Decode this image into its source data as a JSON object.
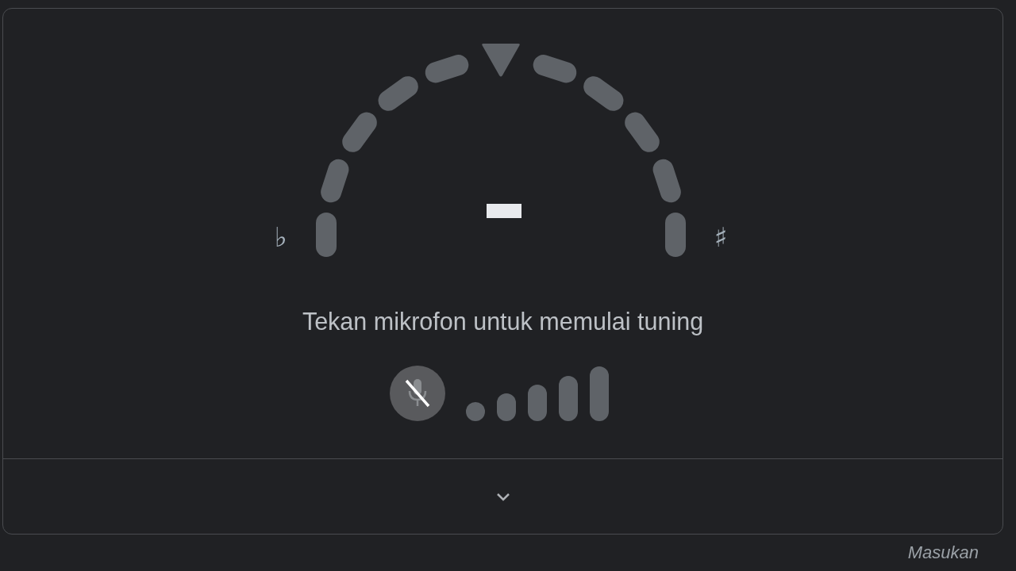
{
  "tuner": {
    "flat_symbol": "♭",
    "sharp_symbol": "♯",
    "instruction": "Tekan mikrofon untuk memulai tuning",
    "microphone": {
      "muted": true
    },
    "expanded": false
  },
  "feedback_link": "Masukan"
}
